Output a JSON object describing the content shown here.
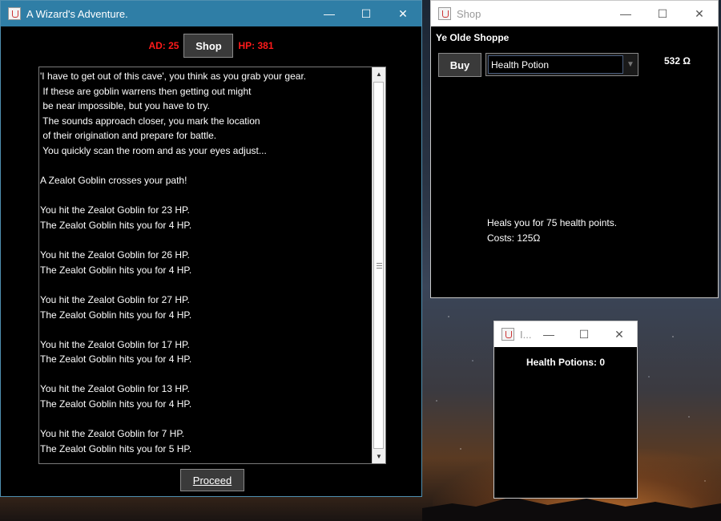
{
  "main_window": {
    "title": "A Wizard's Adventure.",
    "attack_damage": "AD: 25",
    "hit_points": "HP: 381",
    "shop_button": "Shop",
    "log_lines": [
      "'I have to get out of this cave', you think as you grab your gear.",
      " If these are goblin warrens then getting out might",
      " be near impossible, but you have to try.",
      " The sounds approach closer, you mark the location",
      " of their origination and prepare for battle.",
      " You quickly scan the room and as your eyes adjust...",
      "",
      "A Zealot Goblin crosses your path!",
      "",
      "You hit the Zealot Goblin for 23 HP.",
      "The Zealot Goblin hits you for 4 HP.",
      "",
      "You hit the Zealot Goblin for 26 HP.",
      "The Zealot Goblin hits you for 4 HP.",
      "",
      "You hit the Zealot Goblin for 27 HP.",
      "The Zealot Goblin hits you for 4 HP.",
      "",
      "You hit the Zealot Goblin for 17 HP.",
      "The Zealot Goblin hits you for 4 HP.",
      "",
      "You hit the Zealot Goblin for 13 HP.",
      "The Zealot Goblin hits you for 4 HP.",
      "",
      "You hit the Zealot Goblin for 7 HP.",
      "The Zealot Goblin hits you for 5 HP."
    ],
    "proceed_button": "Proceed"
  },
  "shop_window": {
    "title": "Shop",
    "heading": "Ye Olde Shoppe",
    "buy_button": "Buy",
    "selected_item": "Health Potion",
    "gold": "532 Ω",
    "description_line1": "Heals you for 75 health points.",
    "description_line2": "Costs: 125Ω"
  },
  "inventory_window": {
    "title": "I...",
    "potions": "Health Potions: 0"
  },
  "icons": {
    "window": "java-cup-icon",
    "minimize": "minimize-icon",
    "maximize": "maximize-icon",
    "close": "close-icon"
  },
  "colors": {
    "main_titlebar": "#2f7ea6",
    "stat_red": "#ff1a1a"
  }
}
